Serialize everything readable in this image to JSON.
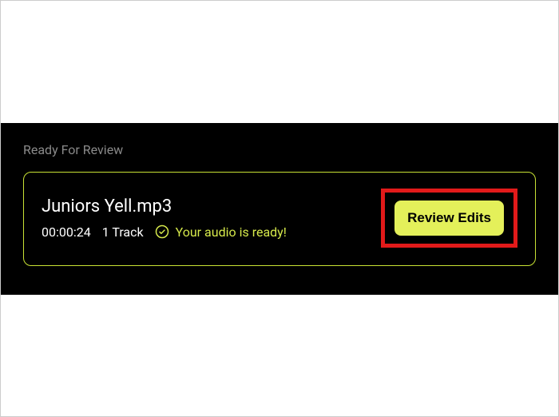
{
  "section": {
    "title": "Ready For Review"
  },
  "item": {
    "filename": "Juniors Yell.mp3",
    "duration": "00:00:24",
    "track_count": "1 Track",
    "status_text": "Your audio is ready!",
    "review_button_label": "Review Edits"
  },
  "colors": {
    "accent": "#d6e94b",
    "border": "#c8e234",
    "highlight": "#e21a1a"
  }
}
